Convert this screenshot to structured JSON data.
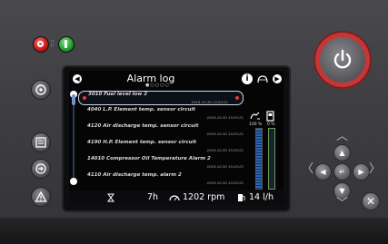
{
  "screen": {
    "title": "Alarm log",
    "page_dots": "●○○○○",
    "info_glyph": "i",
    "alarms": [
      {
        "text": "3010 Fuel level low 2",
        "timestamp": "2018-10-30 13:03:21",
        "selected": true
      },
      {
        "text": "4040 L.P. Element temp. sensor circuit",
        "timestamp": "2018-10-30 13:03:21",
        "selected": false
      },
      {
        "text": "4120 Air discharge temp. sensor circuit",
        "timestamp": "2018-10-30 13:03:21",
        "selected": false
      },
      {
        "text": "4190 H.P. Element temp. sensor circuit",
        "timestamp": "2018-10-30 13:03:21",
        "selected": false
      },
      {
        "text": "14010 Compressor Oil Temperature Alarm 2",
        "timestamp": "2018-10-30 13:03:22",
        "selected": false
      },
      {
        "text": "4110 Air discharge temp. alarm 2",
        "timestamp": "2018-10-30 13:03:21",
        "selected": false
      }
    ],
    "gauges": {
      "label_left": "100 %",
      "label_right": "0 %",
      "fuel_level_fraction": 1.0,
      "def_level_fraction": 0.0
    },
    "status": {
      "hours": "7h",
      "rpm": "1202 rpm",
      "fuel_rate": "14 l/h"
    }
  },
  "colors": {
    "power_ring": "#c73636",
    "selection_dot": "#e23b3b",
    "gauge_fill": "#2a64b8"
  },
  "icons": {
    "lamp_red": "stop-icon",
    "lamp_green": "run-icon",
    "side_1": "engine-icon",
    "side_2": "alarm-list-icon",
    "side_3": "login-icon",
    "side_4": "warning-icon",
    "power": "power-icon"
  }
}
